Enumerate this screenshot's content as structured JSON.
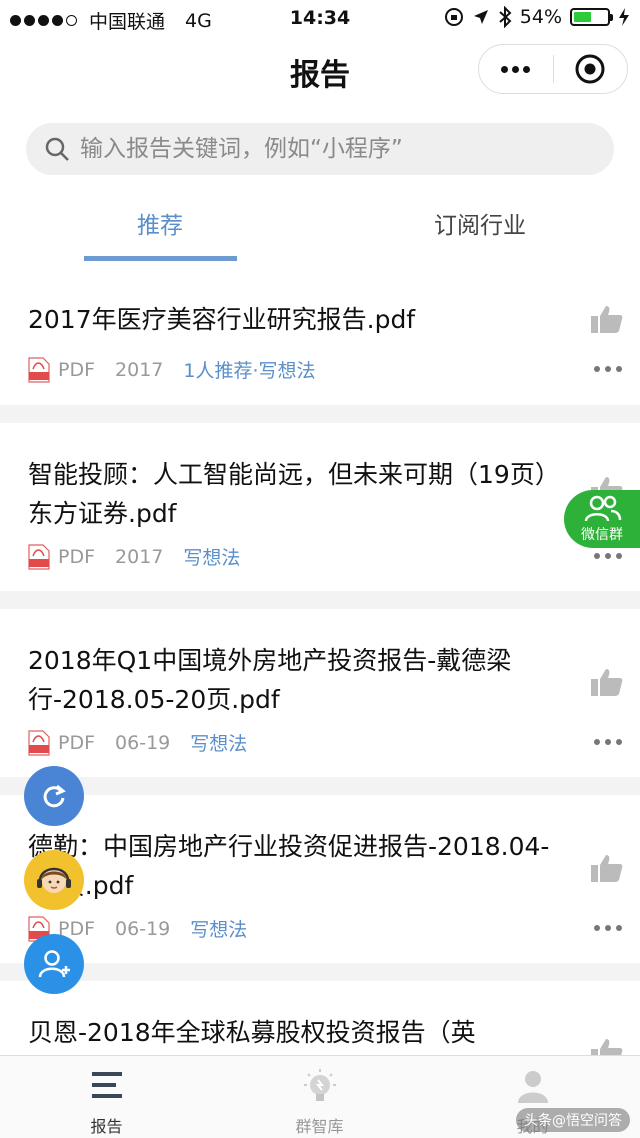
{
  "status_bar": {
    "carrier": "中国联通",
    "network": "4G",
    "time": "14:34",
    "battery": "54%",
    "battery_level": 0.54
  },
  "nav": {
    "title": "报告"
  },
  "search": {
    "placeholder": "输入报告关键词，例如“小程序”"
  },
  "tabs": [
    {
      "label": "推荐",
      "active": true
    },
    {
      "label": "订阅行业",
      "active": false
    }
  ],
  "reports": [
    {
      "title": "2017年医疗美容行业研究报告.pdf",
      "type": "PDF",
      "date": "2017",
      "recommend": "1人推荐·写想法"
    },
    {
      "title": "智能投顾：人工智能尚远，但未来可期（19页）东方证券.pdf",
      "type": "PDF",
      "date": "2017",
      "recommend": "写想法"
    },
    {
      "title": "2018年Q1中国境外房地产投资报告-戴德梁行-2018.05-20页.pdf",
      "type": "PDF",
      "date": "06-19",
      "recommend": "写想法"
    },
    {
      "title": "德勤：中国房地产行业投资促进报告-2018.04-80页.pdf",
      "type": "PDF",
      "date": "06-19",
      "recommend": "写想法"
    },
    {
      "title": "贝恩-2018年全球私募股权投资报告（英",
      "type": "",
      "date": "",
      "recommend": ""
    }
  ],
  "float": {
    "wechat_group": "微信群"
  },
  "tabbar": [
    {
      "label": "报告",
      "icon": "list-icon",
      "active": true
    },
    {
      "label": "群智库",
      "icon": "bulb-icon",
      "active": false
    },
    {
      "label": "我的",
      "icon": "user-icon",
      "active": false
    }
  ],
  "watermark": "头条@悟空问答",
  "colors": {
    "accent": "#5b8fc9",
    "wechat_green": "#2eb139",
    "battery": "#2bcb3c"
  }
}
